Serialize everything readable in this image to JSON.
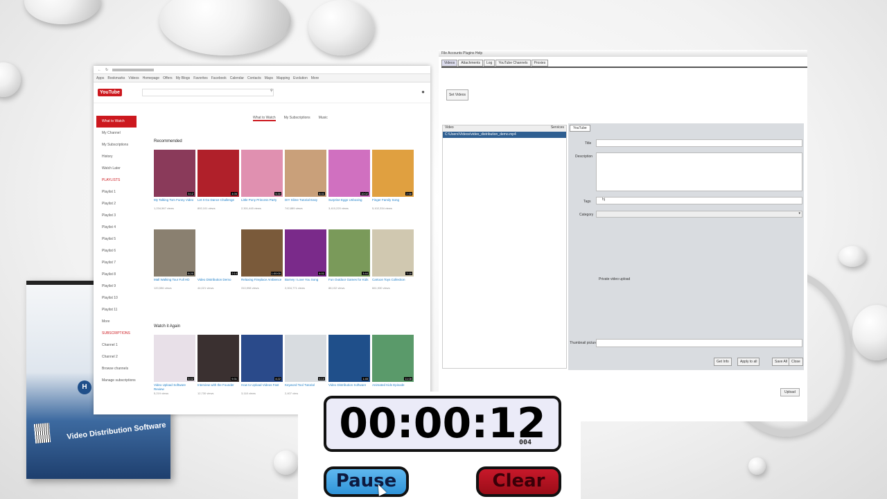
{
  "browser": {
    "bookmarks": [
      "Apps",
      "Bookmarks",
      "Videos",
      "Homepage",
      "Offers",
      "My Blogs",
      "Favorites",
      "Facebook",
      "Calendar",
      "Contacts",
      "Maps",
      "Mapping",
      "Evolution",
      "More"
    ],
    "logo": "YouTube",
    "sidebar": [
      "What to Watch",
      "My Channel",
      "My Subscriptions",
      "History",
      "Watch Later",
      "PLAYLISTS",
      "Playlist 1",
      "Playlist 2",
      "Playlist 3",
      "Playlist 4",
      "Playlist 5",
      "Playlist 6",
      "Playlist 7",
      "Playlist 8",
      "Playlist 9",
      "Playlist 10",
      "Playlist 11",
      "More",
      "SUBSCRIPTIONS",
      "Channel 1",
      "Channel 2",
      "Browse channels",
      "Manage subscriptions"
    ],
    "tabs": [
      "What to Watch",
      "My Subscriptions",
      "Music"
    ],
    "shelves": [
      {
        "title": "Recommended",
        "videos": [
          {
            "title": "My Talking Tom Funny Video",
            "meta": "1,234,567 views",
            "dur": "3:12",
            "color": "#8a3a5a"
          },
          {
            "title": "Let It Go Dance Challenge",
            "meta": "892,101 views",
            "dur": "4:05",
            "color": "#b0202a"
          },
          {
            "title": "Little Pony Princess Party",
            "meta": "2,301,445 views",
            "dur": "5:30",
            "color": "#e090b0"
          },
          {
            "title": "DIY Slime Tutorial Easy",
            "meta": "742,889 views",
            "dur": "8:41",
            "color": "#c9a07a"
          },
          {
            "title": "Surprise Eggs Unboxing",
            "meta": "3,410,220 views",
            "dur": "10:02",
            "color": "#d070c0"
          },
          {
            "title": "Finger Family Song",
            "meta": "5,102,334 views",
            "dur": "2:58",
            "color": "#e0a040"
          }
        ]
      },
      {
        "title": "",
        "videos": [
          {
            "title": "Mall Walking Tour Full HD",
            "meta": "120,556 views",
            "dur": "6:20",
            "color": "#8a8070"
          },
          {
            "title": "Video Distribution Demo",
            "meta": "44,021 views",
            "dur": "2:14",
            "color": "#ffffff"
          },
          {
            "title": "Relaxing Fireplace Ambience",
            "meta": "310,998 views",
            "dur": "1:00:00",
            "color": "#7a5a3a"
          },
          {
            "title": "Barney I Love You Song",
            "meta": "2,004,771 views",
            "dur": "4:01",
            "color": "#7a2a8a"
          },
          {
            "title": "Fun Outdoor Games for Kids",
            "meta": "88,102 views",
            "dur": "3:44",
            "color": "#7a9a5a"
          },
          {
            "title": "Cartoon Toys Collection",
            "meta": "661,930 views",
            "dur": "7:16",
            "color": "#d0c8b0"
          }
        ]
      },
      {
        "title": "Watch it Again",
        "videos": [
          {
            "title": "Video Upload Software Review",
            "meta": "5,219 views",
            "dur": "5:02",
            "color": "#e8e0e8"
          },
          {
            "title": "Interview with the Founder",
            "meta": "12,730 views",
            "dur": "9:31",
            "color": "#3a3030"
          },
          {
            "title": "How to Upload Videos Fast",
            "meta": "3,118 views",
            "dur": "4:22",
            "color": "#2a4a8a"
          },
          {
            "title": "Keyword Tool Tutorial",
            "meta": "2,407 views",
            "dur": "6:10",
            "color": "#d8dce0"
          },
          {
            "title": "Video Distribution Software",
            "meta": "9,874 views",
            "dur": "1:45",
            "color": "#1f4f8a"
          },
          {
            "title": "Animated Kids Episode",
            "meta": "401,552 views",
            "dur": "11:08",
            "color": "#5a9a6a"
          }
        ]
      }
    ]
  },
  "app": {
    "menu": "File Accounts Plugins Help",
    "tabs": [
      "Videos",
      "Attachments",
      "Log",
      "YouTube Channels",
      "Proxies"
    ],
    "set_button": "Set Videos",
    "list_header_left": "Video",
    "list_header_right": "Services",
    "list_row": "C:\\Users\\Videos\\video_distribution_demo.mp4",
    "form_tab": "YouTube",
    "labels": {
      "title": "Title",
      "description": "Description",
      "tags": "Tags",
      "category": "Category",
      "checkbox": "Private video upload",
      "thumbnail": "Thumbnail picture"
    },
    "tags_value": "hj",
    "buttons": [
      "Get Info",
      "Apply to all",
      "Save All",
      "Close"
    ],
    "bottom_button": "Upload"
  },
  "product_box": {
    "name": "Video Distribution Software",
    "logo": "H"
  },
  "timer": {
    "time": "00:00:12",
    "ms": "004",
    "pause_label": "Pause",
    "clear_label": "Clear"
  }
}
